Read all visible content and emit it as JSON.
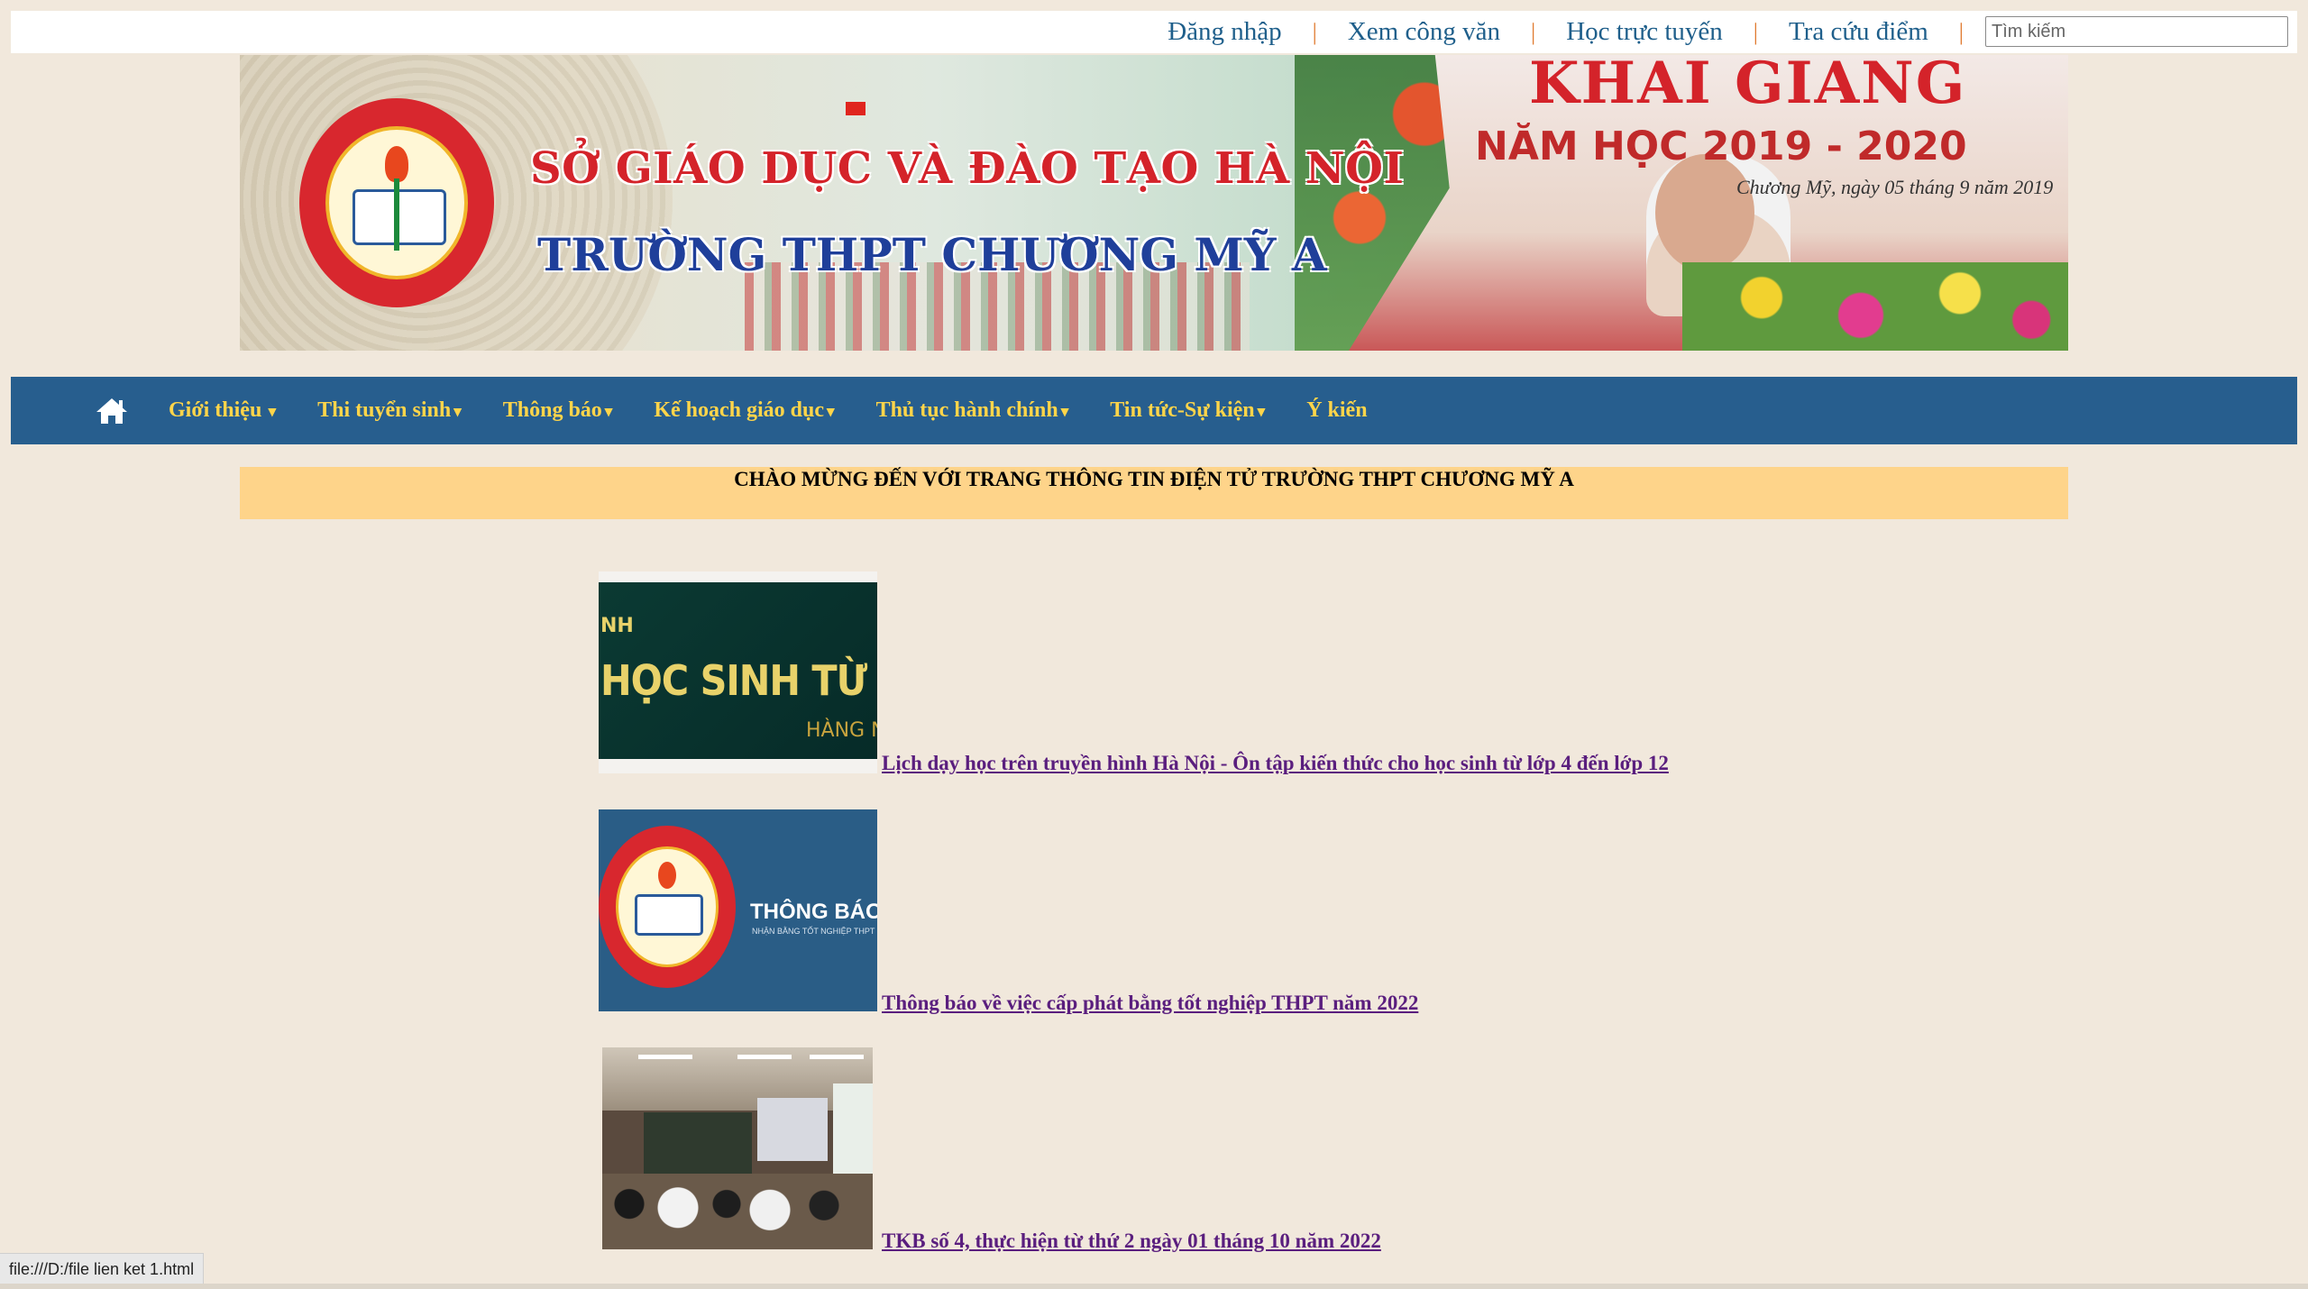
{
  "topbar": {
    "links": [
      "Đăng nhập",
      "Xem công văn",
      "Học trực tuyến",
      "Tra cứu điểm"
    ],
    "separator": "|",
    "search_placeholder": "Tìm kiếm"
  },
  "banner": {
    "line1": "SỞ GIÁO DỤC VÀ ĐÀO TẠO HÀ NỘI",
    "line2": "TRƯỜNG THPT CHƯƠNG MỸ A",
    "event_title": "KHAI GIANG",
    "event_year": "NĂM HỌC 2019 - 2020",
    "event_date": "Chương Mỹ, ngày 05 tháng 9 năm 2019"
  },
  "nav": {
    "home_icon": "home-icon",
    "items": [
      {
        "label": "Giới thiệu",
        "caret": " ▾"
      },
      {
        "label": "Thi tuyển sinh",
        "caret": "▾"
      },
      {
        "label": "Thông báo",
        "caret": "▾"
      },
      {
        "label": "Kế hoạch giáo dục",
        "caret": "▾"
      },
      {
        "label": "Thủ tục hành chính",
        "caret": "▾"
      },
      {
        "label": "Tin tức-Sự kiện",
        "caret": "▾"
      },
      {
        "label": "Ý kiến",
        "caret": ""
      }
    ]
  },
  "welcome": "CHÀO MỪNG ĐẾN VỚI TRANG THÔNG TIN ĐIỆN TỬ TRƯỜNG THPT CHƯƠNG MỸ A",
  "news": [
    {
      "title": "Lịch dạy học trên truyền hình Hà Nội - Ôn tập kiến thức cho học sinh từ lớp 4 đến lớp 12",
      "thumb_text": {
        "top": "NH",
        "main": "HỌC SINH TỪ LỚP",
        "sub": "HÀNG N"
      }
    },
    {
      "title": "Thông báo về việc cấp phát bằng tốt nghiệp THPT năm 2022",
      "thumb_text": {
        "main": "THÔNG BÁO",
        "sub": "NHẬN BẰNG TỐT NGHIỆP THPT"
      }
    },
    {
      "title": "TKB số 4, thực hiện từ thứ 2 ngày 01 tháng 10 năm 2022"
    }
  ],
  "statusbar": "file:///D:/file lien ket 1.html",
  "colors": {
    "page_bg": "#f1e8dc",
    "nav_bg": "#275e8e",
    "nav_text": "#ffd54a",
    "welcome_bg": "#fed48a",
    "link_visited": "#5a1e7e",
    "toplink": "#1f5f8b"
  }
}
